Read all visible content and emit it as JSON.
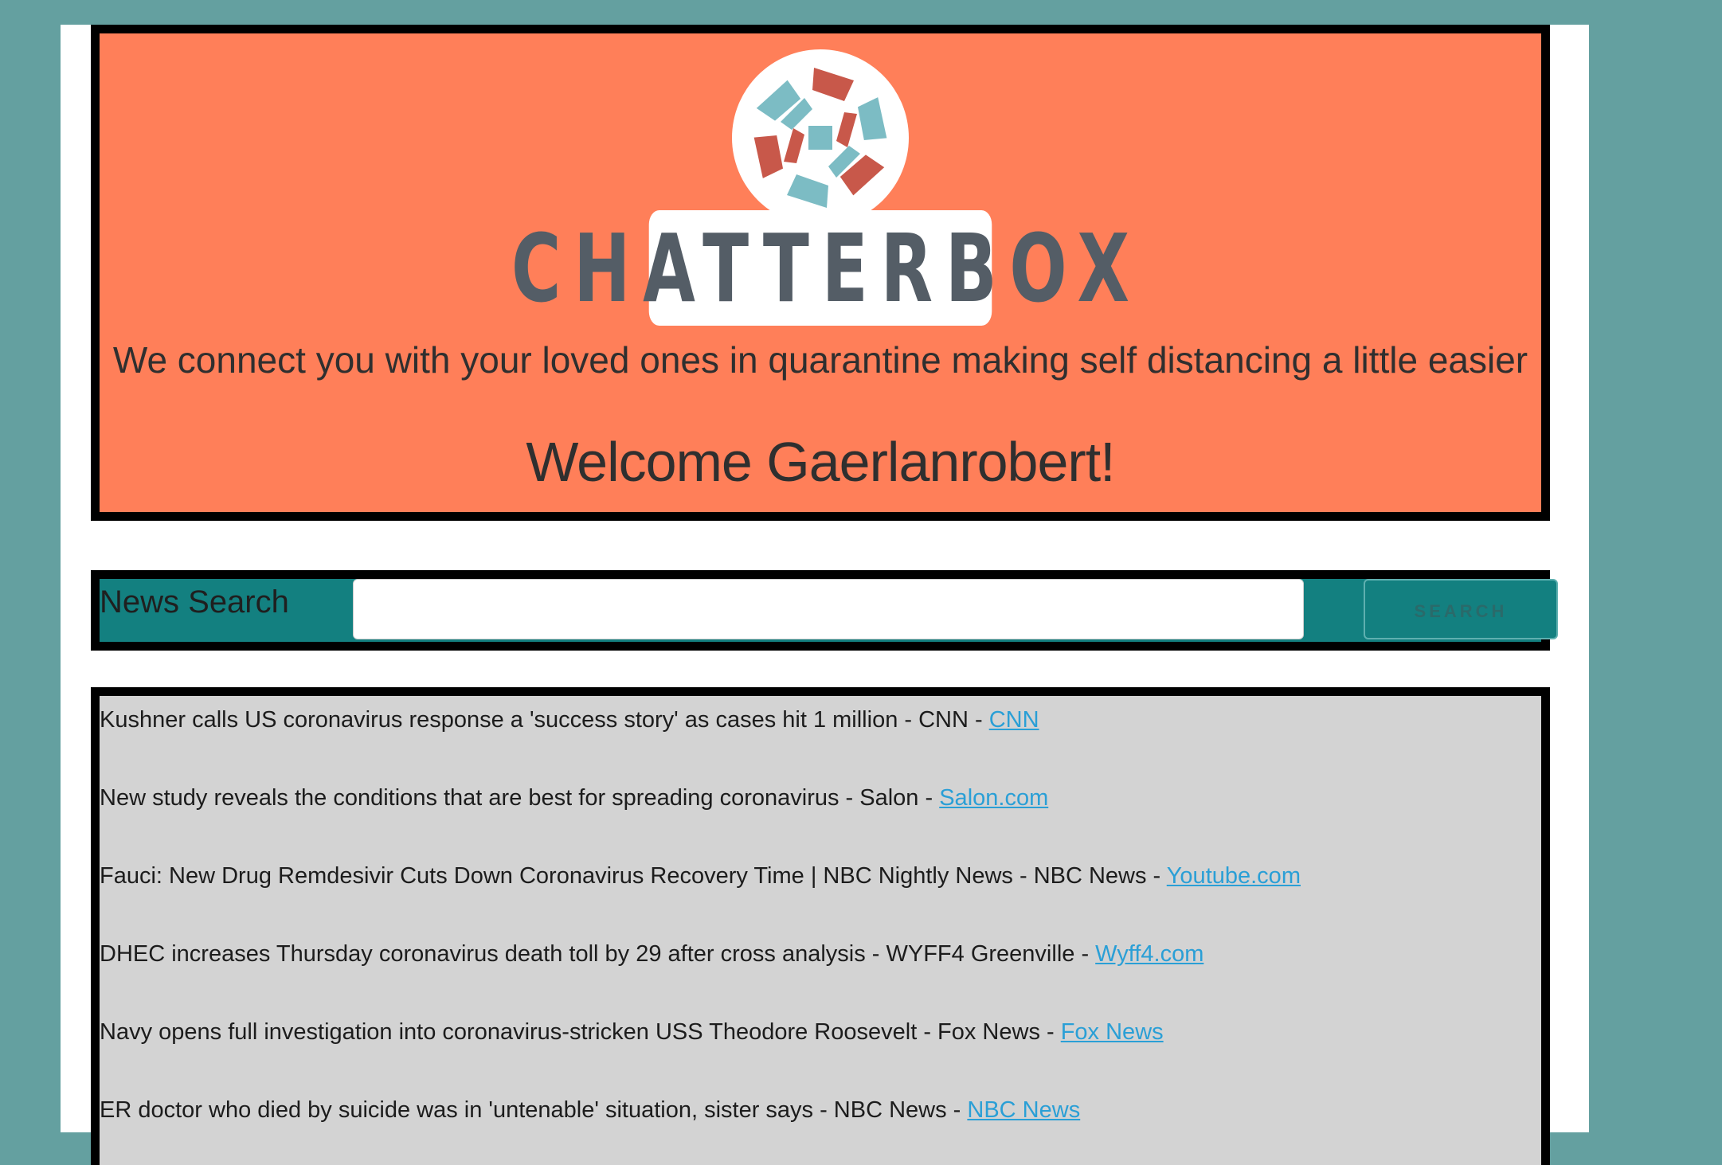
{
  "brand": {
    "name": "CHATTERBOX"
  },
  "header": {
    "tagline": "We connect you with your loved ones in quarantine making self distancing a little easier",
    "welcome": "Welcome Gaerlanrobert!"
  },
  "search": {
    "label": "News Search",
    "input_value": "",
    "button_label": "SEARCH"
  },
  "news": [
    {
      "text": "Kushner calls US coronavirus response a 'success story' as cases hit 1 million - CNN - ",
      "source": "CNN"
    },
    {
      "text": "New study reveals the conditions that are best for spreading coronavirus - Salon - ",
      "source": "Salon.com"
    },
    {
      "text": "Fauci: New Drug Remdesivir Cuts Down Coronavirus Recovery Time | NBC Nightly News - NBC News - ",
      "source": "Youtube.com"
    },
    {
      "text": "DHEC increases Thursday coronavirus death toll by 29 after cross analysis - WYFF4 Greenville - ",
      "source": "Wyff4.com"
    },
    {
      "text": "Navy opens full investigation into coronavirus-stricken USS Theodore Roosevelt - Fox News - ",
      "source": "Fox News"
    },
    {
      "text": "ER doctor who died by suicide was in 'untenable' situation, sister says - NBC News - ",
      "source": "NBC News"
    }
  ],
  "colors": {
    "background": "#64a0a0",
    "header_bg": "#ff7f59",
    "search_bg": "#138080",
    "news_bg": "#d3d3d3",
    "link": "#2a9fd6",
    "logo_red": "#c8584a",
    "logo_teal": "#7cbcc4"
  }
}
